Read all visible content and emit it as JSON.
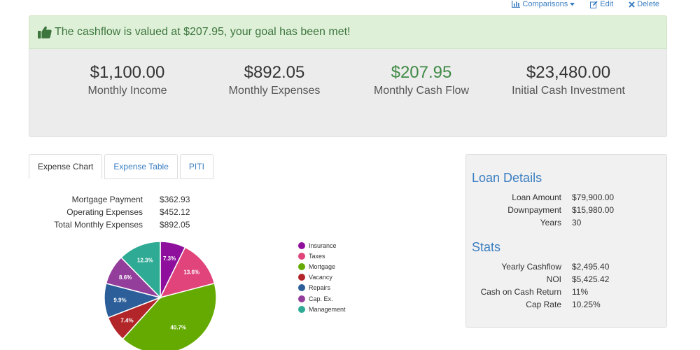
{
  "actions": {
    "comparisons": "Comparisons",
    "edit": "Edit",
    "delete": "Delete"
  },
  "alert": {
    "message": "The cashflow is valued at $207.95, your goal has been met!"
  },
  "summary": [
    {
      "value": "$1,100.00",
      "label": "Monthly Income"
    },
    {
      "value": "$892.05",
      "label": "Monthly Expenses"
    },
    {
      "value": "$207.95",
      "label": "Monthly Cash Flow"
    },
    {
      "value": "$23,480.00",
      "label": "Initial Cash Investment"
    }
  ],
  "tabs": [
    "Expense Chart",
    "Expense Table",
    "PITI"
  ],
  "expense_summary": [
    {
      "label": "Mortgage Payment",
      "value": "$362.93"
    },
    {
      "label": "Operating Expenses",
      "value": "$452.12"
    },
    {
      "label": "Total Monthly Expenses",
      "value": "$892.05"
    }
  ],
  "pie": {
    "slices": [
      {
        "name": "Insurance",
        "percent": 7.3,
        "label": "7.3%",
        "color": "#8e0f9c"
      },
      {
        "name": "Taxes",
        "percent": 13.6,
        "label": "13.6%",
        "color": "#e0447a"
      },
      {
        "name": "Mortgage",
        "percent": 40.7,
        "label": "40.7%",
        "color": "#64aa00"
      },
      {
        "name": "Vacancy",
        "percent": 7.4,
        "label": "7.4%",
        "color": "#b2262a"
      },
      {
        "name": "Repairs",
        "percent": 9.9,
        "label": "9.9%",
        "color": "#2c5e99"
      },
      {
        "name": "Cap. Ex.",
        "percent": 8.6,
        "label": "8.6%",
        "color": "#943e9c"
      },
      {
        "name": "Management",
        "percent": 12.3,
        "label": "12.3%",
        "color": "#2faa95"
      }
    ]
  },
  "loan_details": {
    "title": "Loan Details",
    "rows": [
      {
        "label": "Loan Amount",
        "value": "$79,900.00"
      },
      {
        "label": "Downpayment",
        "value": "$15,980.00"
      },
      {
        "label": "Years",
        "value": "30"
      }
    ]
  },
  "stats": {
    "title": "Stats",
    "rows": [
      {
        "label": "Yearly Cashflow",
        "value": "$2,495.40"
      },
      {
        "label": "NOI",
        "value": "$5,425.42"
      },
      {
        "label": "Cash on Cash Return",
        "value": "11%"
      },
      {
        "label": "Cap Rate",
        "value": "10.25%"
      }
    ]
  }
}
